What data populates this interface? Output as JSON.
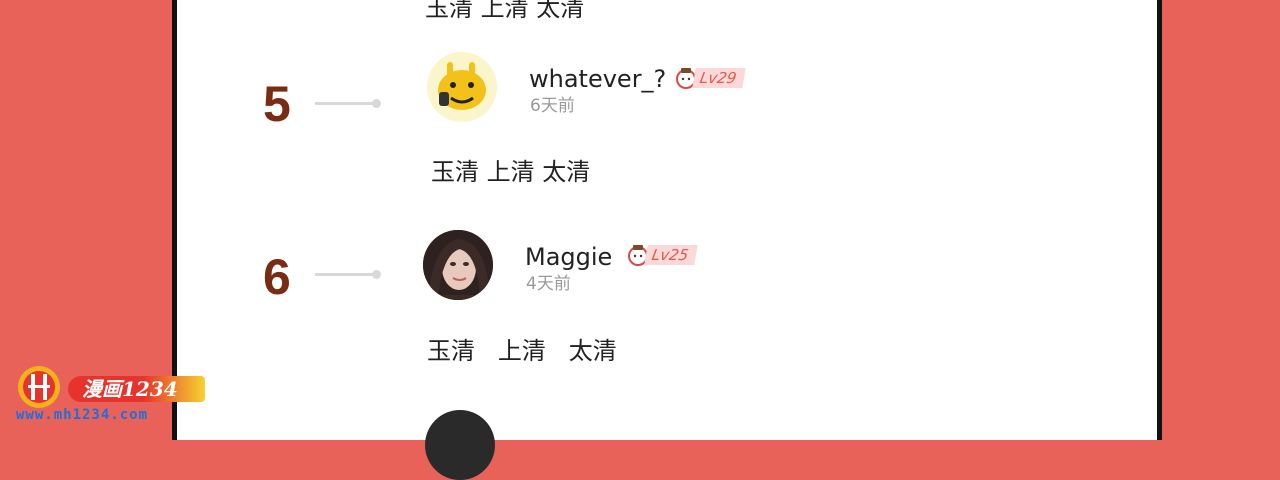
{
  "comments": [
    {
      "number": "5",
      "username": "whatever_?",
      "level": "Lv29",
      "time": "6天前",
      "text": "玉清 上清 太清"
    },
    {
      "number": "6",
      "username": "Maggie",
      "level": "Lv25",
      "time": "4天前",
      "text": "玉清   上清   太清"
    }
  ],
  "top_partial_text": "玉清 上清 太清",
  "watermark": {
    "badge": "漫画1234",
    "url": "www.mh1234.com"
  },
  "colors": {
    "background": "#e8625a",
    "number": "#7a2c12",
    "level_badge": "#e15a52",
    "watermark_url": "#1d6fe0"
  }
}
